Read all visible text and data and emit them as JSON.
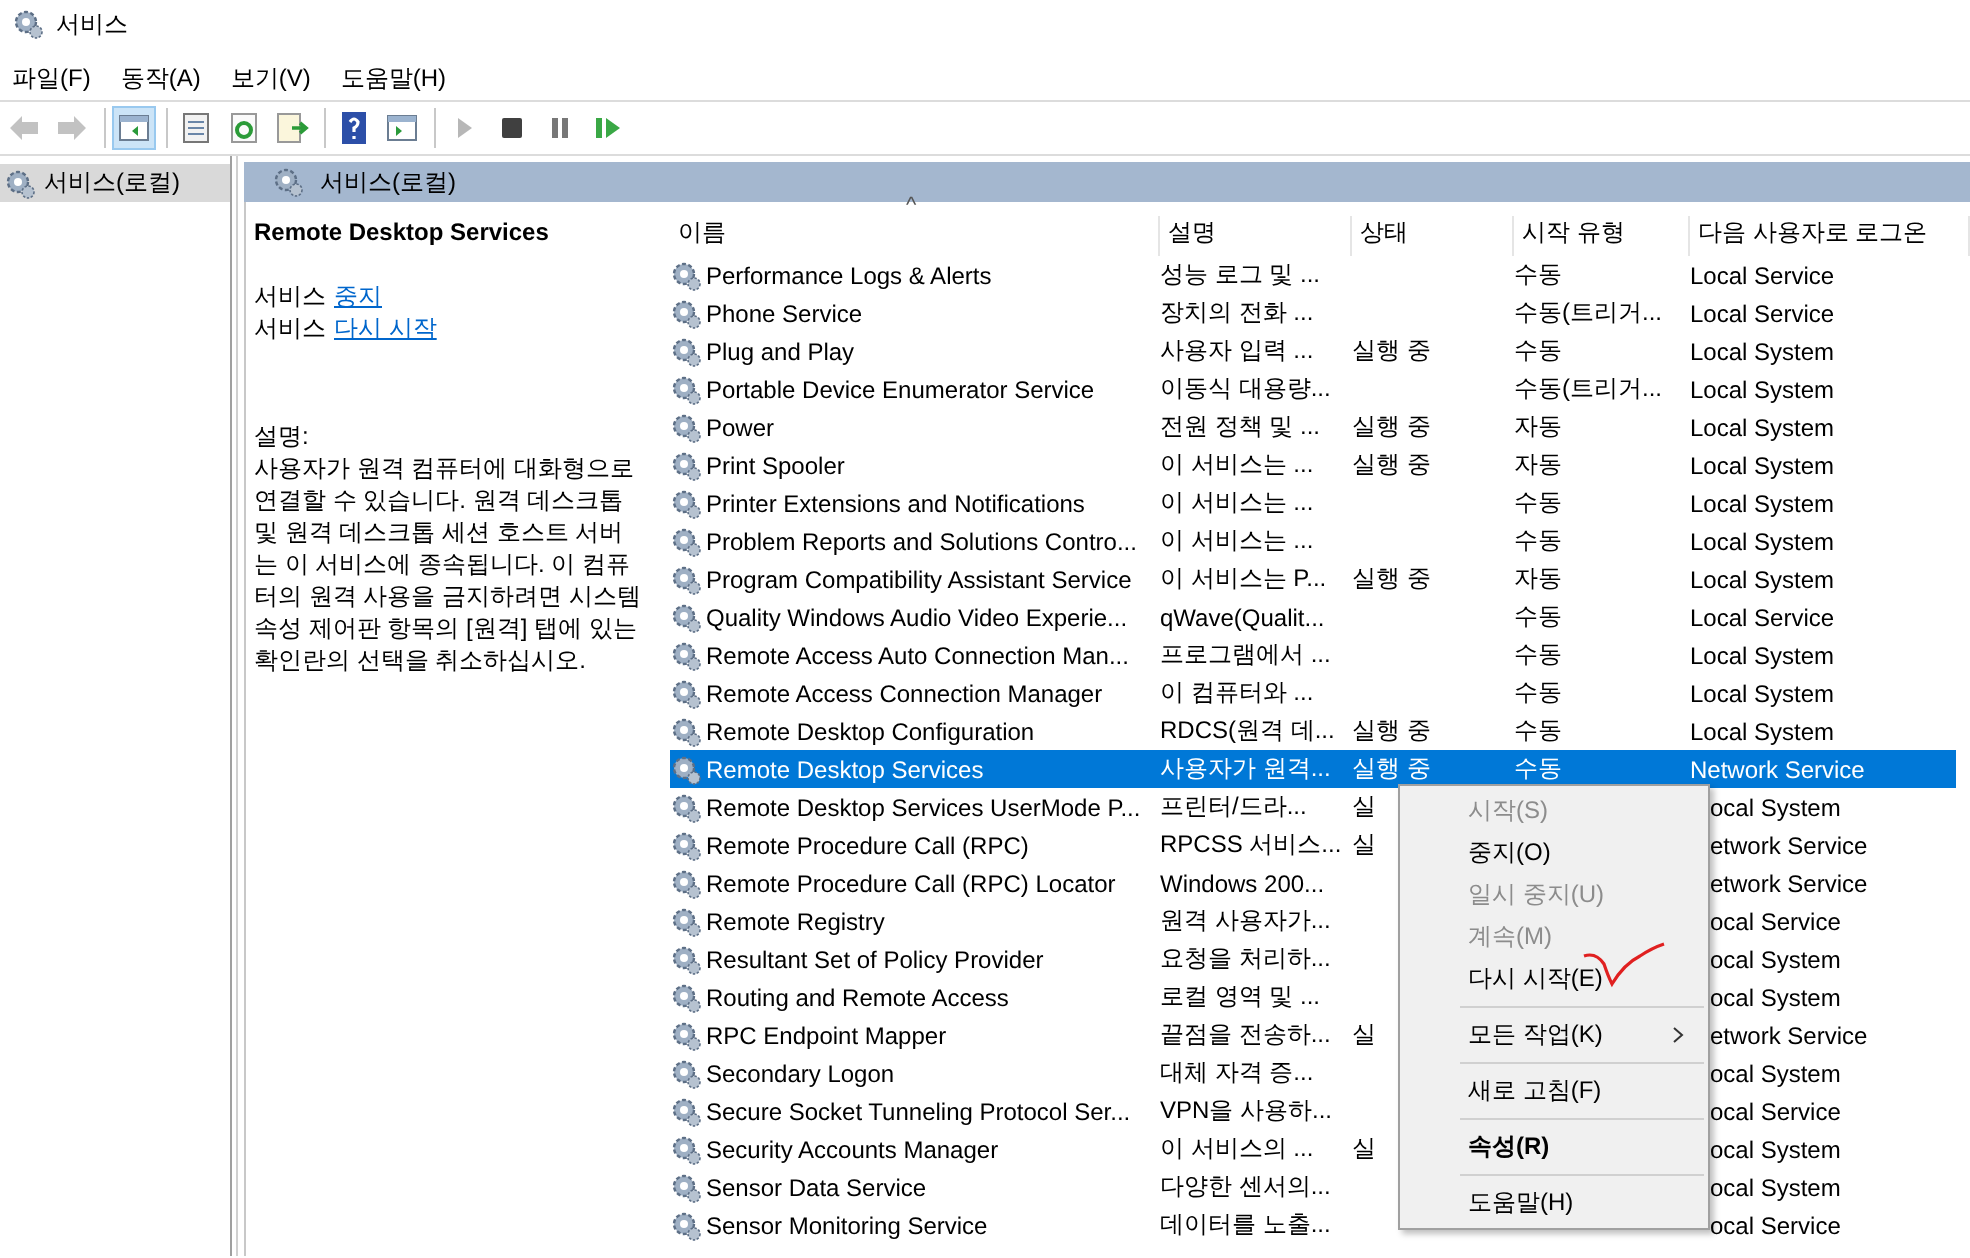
{
  "window": {
    "title": "서비스"
  },
  "menu_bar": [
    "파일(F)",
    "동작(A)",
    "보기(V)",
    "도움말(H)"
  ],
  "toolbar": [
    {
      "kind": "back",
      "disabled": true
    },
    {
      "kind": "forward",
      "disabled": true
    },
    {
      "kind": "sep"
    },
    {
      "kind": "tree",
      "pressed": true
    },
    {
      "kind": "sep"
    },
    {
      "kind": "properties",
      "disabled": false
    },
    {
      "kind": "refresh",
      "disabled": false
    },
    {
      "kind": "export",
      "disabled": false
    },
    {
      "kind": "sep"
    },
    {
      "kind": "help",
      "disabled": false
    },
    {
      "kind": "action-pane",
      "disabled": false
    },
    {
      "kind": "sep"
    },
    {
      "kind": "play",
      "disabled": true
    },
    {
      "kind": "stop",
      "disabled": false
    },
    {
      "kind": "pause",
      "disabled": false
    },
    {
      "kind": "resume",
      "disabled": false
    }
  ],
  "tree": {
    "items": [
      {
        "label": "서비스(로컬)",
        "selected": true
      }
    ]
  },
  "pane_header": "서비스(로컬)",
  "detail": {
    "title": "Remote Desktop Services",
    "actions": [
      {
        "prefix": "서비스",
        "link": "중지"
      },
      {
        "prefix": "서비스",
        "link": "다시 시작"
      }
    ],
    "description_label": "설명:",
    "description": "사용자가 원격 컴퓨터에 대화형으로 연결할 수 있습니다. 원격 데스크톱 및 원격 데스크톱 세션 호스트 서버는 이 서비스에 종속됩니다. 이 컴퓨터의 원격 사용을 금지하려면 시스템 속성 제어판 항목의 [원격] 탭에 있는 확인란의 선택을 취소하십시오."
  },
  "table": {
    "columns": [
      "이름",
      "설명",
      "상태",
      "시작 유형",
      "다음 사용자로 로그온"
    ],
    "sort_indicator": "^",
    "rows": [
      {
        "name": "Performance Logs & Alerts",
        "description": "성능 로그 및 ...",
        "start_type": "수동",
        "log_on": "Local Service",
        "selected": false
      },
      {
        "name": "Phone Service",
        "description": "장치의 전화 ...",
        "start_type": "수동(트리거...",
        "log_on": "Local Service",
        "selected": false
      },
      {
        "name": "Plug and Play",
        "description": "사용자 입력 ...",
        "status": "실행 중",
        "start_type": "수동",
        "log_on": "Local System",
        "selected": false
      },
      {
        "name": "Portable Device Enumerator Service",
        "description": "이동식 대용량...",
        "start_type": "수동(트리거...",
        "log_on": "Local System",
        "selected": false
      },
      {
        "name": "Power",
        "description": "전원 정책 및 ...",
        "status": "실행 중",
        "start_type": "자동",
        "log_on": "Local System",
        "selected": false
      },
      {
        "name": "Print Spooler",
        "description": "이 서비스는 ...",
        "status": "실행 중",
        "start_type": "자동",
        "log_on": "Local System",
        "selected": false
      },
      {
        "name": "Printer Extensions and Notifications",
        "description": "이 서비스는 ...",
        "start_type": "수동",
        "log_on": "Local System",
        "selected": false
      },
      {
        "name": "Problem Reports and Solutions Contro...",
        "description": "이 서비스는 ...",
        "start_type": "수동",
        "log_on": "Local System",
        "selected": false
      },
      {
        "name": "Program Compatibility Assistant Service",
        "description": "이 서비스는 P...",
        "status": "실행 중",
        "start_type": "자동",
        "log_on": "Local System",
        "selected": false
      },
      {
        "name": "Quality Windows Audio Video Experie...",
        "description": "qWave(Qualit...",
        "start_type": "수동",
        "log_on": "Local Service",
        "selected": false
      },
      {
        "name": "Remote Access Auto Connection Man...",
        "description": "프로그램에서 ...",
        "start_type": "수동",
        "log_on": "Local System",
        "selected": false
      },
      {
        "name": "Remote Access Connection Manager",
        "description": "이 컴퓨터와 ...",
        "start_type": "수동",
        "log_on": "Local System",
        "selected": false
      },
      {
        "name": "Remote Desktop Configuration",
        "description": "RDCS(원격 데...",
        "status": "실행 중",
        "start_type": "수동",
        "log_on": "Local System",
        "selected": false
      },
      {
        "name": "Remote Desktop Services",
        "description": "사용자가 원격...",
        "status": "실행 중",
        "start_type": "수동",
        "log_on": "Network Service",
        "selected": true
      },
      {
        "name": "Remote Desktop Services UserMode P...",
        "description": "프린터/드라...",
        "status": "실",
        "log_on": "ocal System",
        "selected": false
      },
      {
        "name": "Remote Procedure Call (RPC)",
        "description": "RPCSS 서비스...",
        "status": "실",
        "log_on": "etwork Service",
        "selected": false
      },
      {
        "name": "Remote Procedure Call (RPC) Locator",
        "description": "Windows 200...",
        "log_on": "etwork Service",
        "selected": false
      },
      {
        "name": "Remote Registry",
        "description": "원격 사용자가...",
        "log_on": "ocal Service",
        "selected": false
      },
      {
        "name": "Resultant Set of Policy Provider",
        "description": "요청을 처리하...",
        "log_on": "ocal System",
        "selected": false
      },
      {
        "name": "Routing and Remote Access",
        "description": "로컬 영역 및 ...",
        "log_on": "ocal System",
        "selected": false
      },
      {
        "name": "RPC Endpoint Mapper",
        "description": "끝점을 전송하...",
        "status": "실",
        "log_on": "etwork Service",
        "selected": false
      },
      {
        "name": "Secondary Logon",
        "description": "대체 자격 증...",
        "log_on": "ocal System",
        "selected": false
      },
      {
        "name": "Secure Socket Tunneling Protocol Ser...",
        "description": "VPN을 사용하...",
        "log_on": "ocal Service",
        "selected": false
      },
      {
        "name": "Security Accounts Manager",
        "description": "이 서비스의 ...",
        "status": "실",
        "log_on": "ocal System",
        "selected": false
      },
      {
        "name": "Sensor Data Service",
        "description": "다양한 센서의...",
        "log_on": "ocal System",
        "selected": false
      },
      {
        "name": "Sensor Monitoring Service",
        "description": "데이터를 노출...",
        "log_on": "ocal Service",
        "selected": false
      }
    ]
  },
  "context_menu": [
    {
      "kind": "item",
      "label": "시작(S)",
      "disabled": true
    },
    {
      "kind": "item",
      "label": "중지(O)",
      "disabled": false
    },
    {
      "kind": "item",
      "label": "일시 중지(U)",
      "disabled": true
    },
    {
      "kind": "item",
      "label": "계속(M)",
      "disabled": true
    },
    {
      "kind": "item",
      "label": "다시 시작(E)",
      "disabled": false
    },
    {
      "kind": "separator"
    },
    {
      "kind": "item",
      "label": "모든 작업(K)",
      "disabled": false,
      "submenu": true
    },
    {
      "kind": "separator"
    },
    {
      "kind": "item",
      "label": "새로 고침(F)",
      "disabled": false
    },
    {
      "kind": "separator"
    },
    {
      "kind": "item",
      "label": "속성(R)",
      "disabled": false,
      "default": true
    },
    {
      "kind": "separator"
    },
    {
      "kind": "item",
      "label": "도움말(H)",
      "disabled": false
    }
  ]
}
